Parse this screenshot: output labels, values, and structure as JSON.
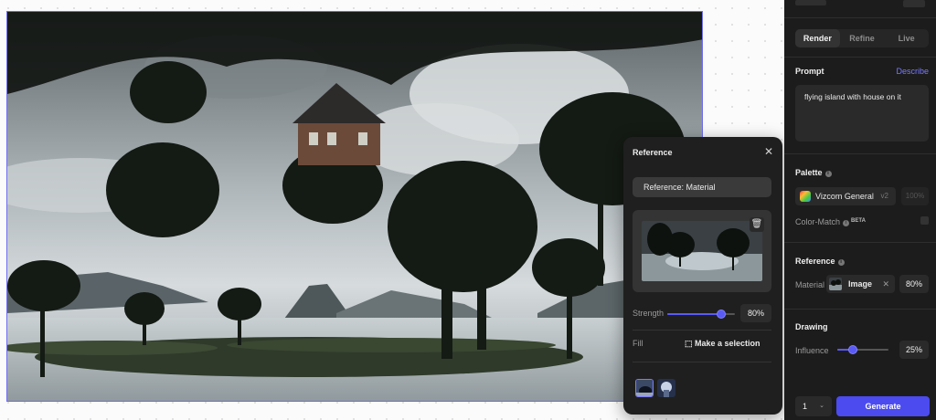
{
  "reference_popup": {
    "title": "Reference",
    "close_icon": "close-icon",
    "material_button": "Reference: Material",
    "strength_label": "Strength",
    "strength_value": "80%",
    "strength_fraction": 0.8,
    "fill_label": "Fill",
    "make_selection": "Make a selection"
  },
  "sidebar": {
    "tabs": [
      {
        "label": "Render",
        "active": true
      },
      {
        "label": "Refine",
        "active": false
      },
      {
        "label": "Live",
        "active": false
      }
    ],
    "prompt": {
      "title": "Prompt",
      "describe": "Describe",
      "text": "flying island with house on it"
    },
    "palette": {
      "title": "Palette",
      "name": "Vizcom General",
      "version": "v2",
      "percent": "100%",
      "color_match": "Color-Match",
      "beta": "BETA"
    },
    "reference": {
      "title": "Reference",
      "material_label": "Material",
      "chip_label": "Image",
      "value": "80%"
    },
    "drawing": {
      "title": "Drawing",
      "influence_label": "Influence",
      "value": "25%",
      "fraction": 0.25
    },
    "generate": {
      "count": "1",
      "label": "Generate"
    }
  },
  "colors": {
    "accent": "#4b4bf0",
    "panel": "#1c1c1c",
    "popup": "#1f1f1f"
  }
}
